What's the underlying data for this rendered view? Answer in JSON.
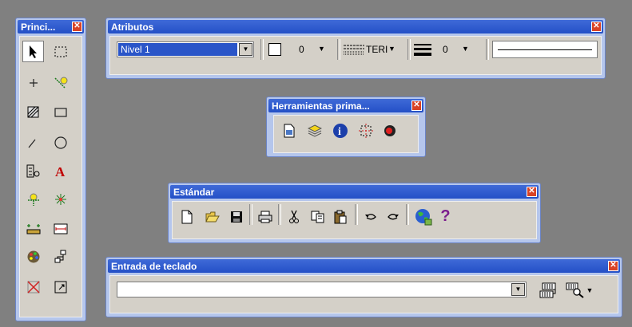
{
  "principal": {
    "title": "Princi...",
    "tools": [
      "select-arrow-icon",
      "rect-select-icon",
      "point-plus-icon",
      "bulb-line-icon",
      "hatch-area-icon",
      "rectangle-icon",
      "arc-line-icon",
      "circle-icon",
      "cell-place-icon",
      "text-a-icon",
      "lamp-dim-icon",
      "star-point-icon",
      "measure-icon",
      "dimension-icon",
      "palette-icon",
      "tree-icon",
      "delete-x-icon",
      "fence-icon"
    ]
  },
  "atributos": {
    "title": "Atributos",
    "level_value": "Nivel 1",
    "color_value": "0",
    "style_label": "TERI",
    "weight_value": "0"
  },
  "herramientas": {
    "title": "Herramientas prima...",
    "tools": [
      "file-icon",
      "layers-icon",
      "info-icon",
      "snap-icon",
      "record-icon"
    ]
  },
  "estandar": {
    "title": "Estándar",
    "tools": [
      "new-file-icon",
      "open-icon",
      "save-icon",
      "print-icon",
      "cut-icon",
      "copy-icon",
      "paste-icon",
      "undo-icon",
      "redo-icon",
      "globe-icon",
      "help-icon"
    ],
    "help_label": "?"
  },
  "teclado": {
    "title": "Entrada de teclado",
    "input_value": ""
  },
  "close_label": "✕"
}
